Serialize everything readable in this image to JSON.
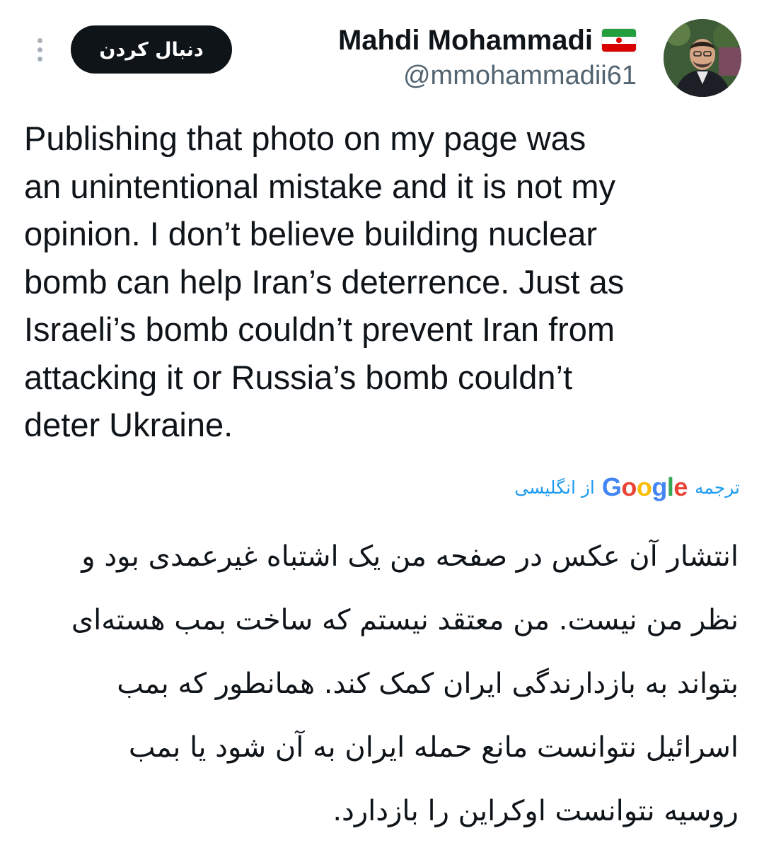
{
  "header": {
    "follow_label": "دنبال کردن",
    "display_name": "Mahdi Mohammadi",
    "handle": "@mmohammadii61",
    "icons": {
      "more": "more-vertical-icon",
      "flag": "iran-flag-icon",
      "avatar": "user-avatar"
    }
  },
  "tweet": {
    "text": "Publishing that photo on my page was\nan unintentional mistake and it is not my\nopinion. I don’t believe building nuclear\nbomb can help Iran’s deterrence. Just as\nIsraeli’s bomb couldn’t prevent Iran from\nattacking it or Russia’s bomb couldn’t\ndeter Ukraine."
  },
  "translation": {
    "label": "ترجمه",
    "brand": "Google",
    "from_language": "از انگلیسی",
    "text": "انتشار آن عکس در صفحه من یک اشتباه غیرعمدی بود و\nنظر من نیست. من معتقد نیستم که ساخت بمب هسته‌ای\nبتواند به بازدارندگی ایران کمک کند. همانطور که بمب\nاسرائیل نتوانست مانع حمله ایران به آن شود یا بمب\nروسیه نتوانست اوکراین را بازدارد."
  },
  "colors": {
    "text_primary": "#0f1419",
    "text_secondary": "#536471",
    "link": "#1d9bf0",
    "follow_button_bg": "#0f1419"
  }
}
